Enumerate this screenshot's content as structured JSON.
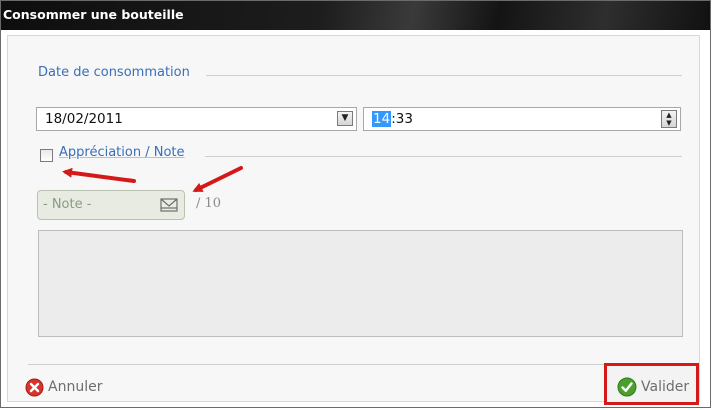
{
  "window": {
    "title": "Consommer une bouteille"
  },
  "consumption": {
    "group_label": "Date de consommation",
    "date_value": "18/02/2011",
    "time_hour": "14",
    "time_rest": ":33"
  },
  "rating": {
    "checkbox_label": "Appréciation / Note",
    "checked": false,
    "note_placeholder": "- Note -",
    "out_of": "/ 10"
  },
  "footer": {
    "cancel_label": "Annuler",
    "validate_label": "Valider"
  },
  "colors": {
    "group_title": "#3a6fb7",
    "annotation_red": "#d41919",
    "cancel_icon": "#d9342b",
    "validate_icon": "#4aa02c"
  }
}
